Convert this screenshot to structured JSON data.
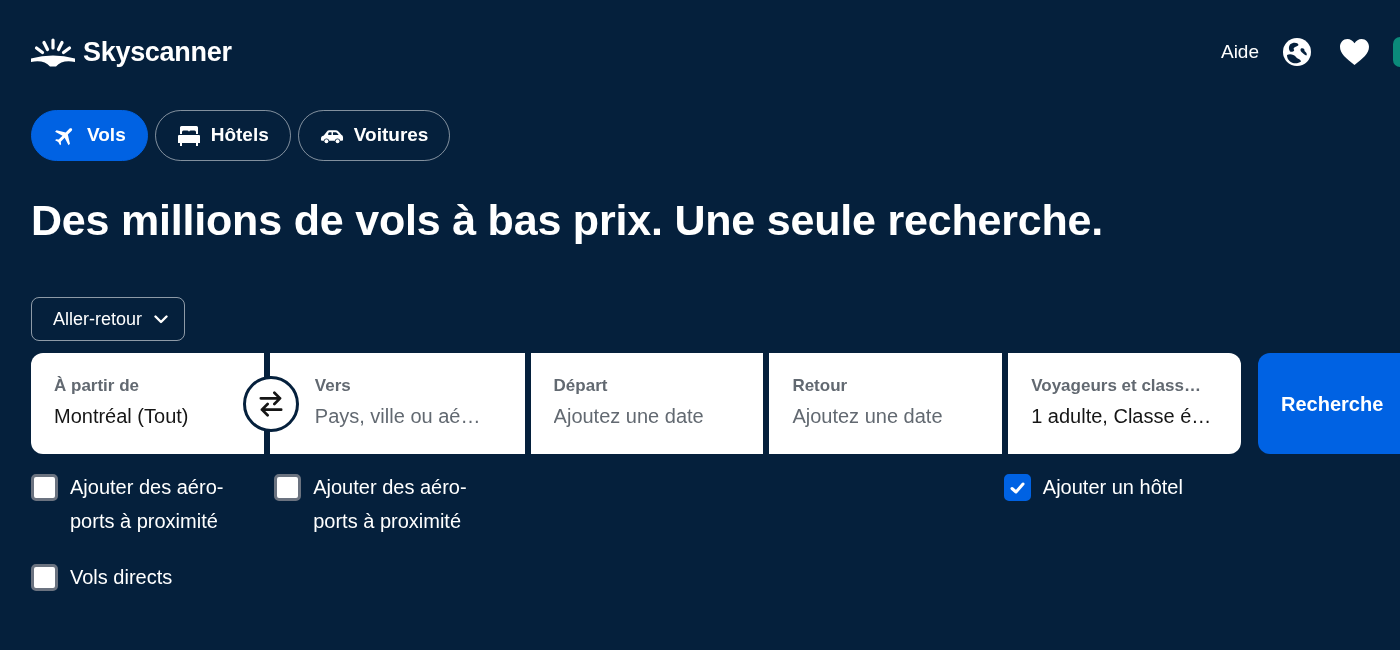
{
  "header": {
    "brand": "Skyscanner",
    "help_link": "Aide"
  },
  "tabs": [
    {
      "label": "Vols",
      "kind": "flights",
      "selected": true
    },
    {
      "label": "Hôtels",
      "kind": "hotels",
      "selected": false
    },
    {
      "label": "Voitures",
      "kind": "cars",
      "selected": false
    }
  ],
  "headline": "Des millions de vols à bas prix. Une seule recherche.",
  "trip_type": {
    "value": "Aller-retour"
  },
  "search_fields": [
    {
      "label": "À partir de",
      "value": "Montréal (Tout)",
      "option": {
        "label": "Ajouter des aéro-ports à proximité",
        "checked": false
      }
    },
    {
      "label": "Vers",
      "placeholder": "Pays, ville ou aé…",
      "option": {
        "label": "Ajouter des aéro-ports à proximité",
        "checked": false
      }
    },
    {
      "label": "Départ",
      "placeholder": "Ajoutez une date"
    },
    {
      "label": "Retour",
      "placeholder": "Ajoutez une date"
    },
    {
      "label": "Voyageurs et class…",
      "value": "1 adulte, Classe é…",
      "option": {
        "label": "Ajouter un hôtel",
        "checked": true
      }
    }
  ],
  "search_button": {
    "label": "Recherche"
  },
  "extra_options": [
    {
      "label": "Vols directs",
      "checked": false
    }
  ]
}
